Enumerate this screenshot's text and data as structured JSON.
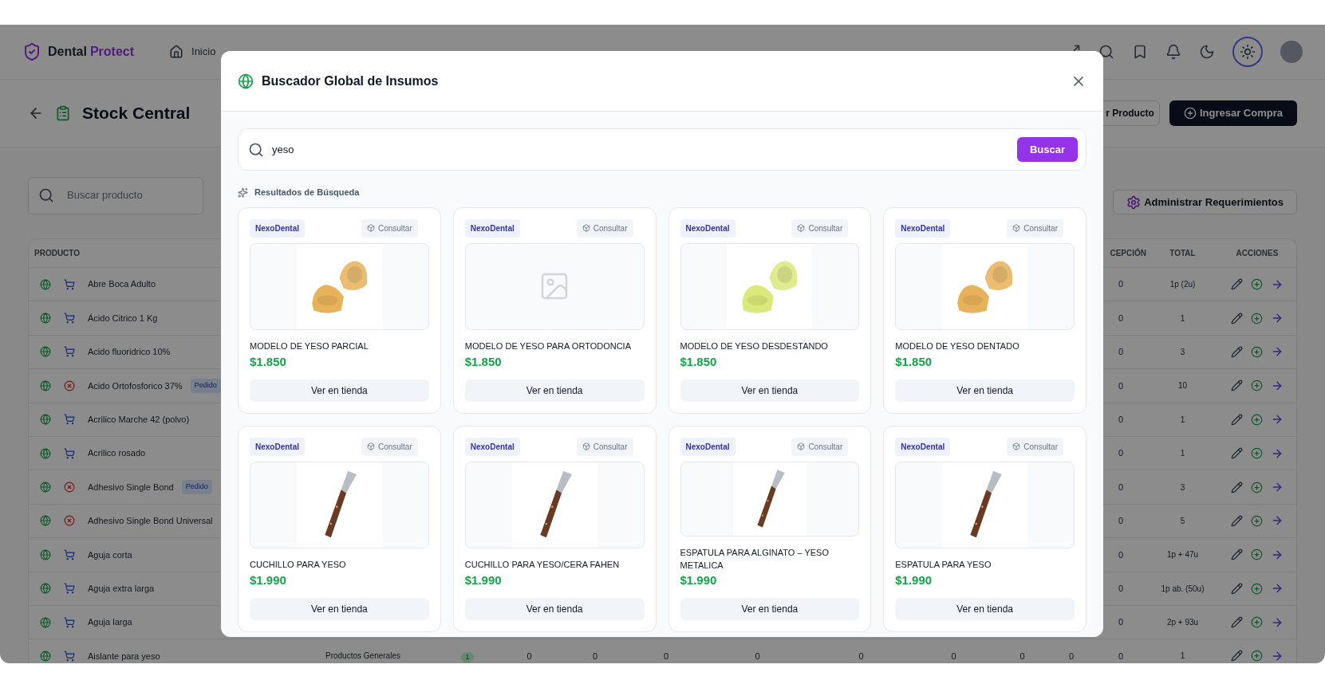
{
  "brand": {
    "name": "Dental",
    "accent": "Protect"
  },
  "nav": [
    "Inicio"
  ],
  "page": {
    "title": "Stock Central",
    "buttons": [
      "r Producto",
      "Ingresar Compra"
    ],
    "search": {
      "placeholder": "Buscar producto"
    },
    "manage_button": "Administrar Requerimientos"
  },
  "table": {
    "columns": {
      "product": "PRODUCTO",
      "reception": "CEPCIÓN",
      "total": "TOTAL",
      "actions": "ACCIONES"
    },
    "rows": [
      {
        "name": "Abre Boca Adulto",
        "kind": "cart",
        "reception": "0",
        "total": "1p (2u)"
      },
      {
        "name": "Ácido Citrico 1 Kg",
        "kind": "cart",
        "reception": "0",
        "total": "1"
      },
      {
        "name": "Acido fluoridrico 10%",
        "kind": "cart",
        "reception": "0",
        "total": "3"
      },
      {
        "name": "Acido Ortofosforico 37%",
        "kind": "cancel",
        "badge": "Pedido",
        "reception": "0",
        "total": "10"
      },
      {
        "name": "Acrilico Marche 42 (polvo)",
        "kind": "cart",
        "reception": "0",
        "total": "1"
      },
      {
        "name": "Acrilico rosado",
        "kind": "cart",
        "reception": "0",
        "total": "1"
      },
      {
        "name": "Adhesivo Single Bond",
        "kind": "cancel",
        "badge": "Pedido",
        "reception": "0",
        "total": "3"
      },
      {
        "name": "Adhesivo Single Bond Universal",
        "kind": "cancel",
        "reception": "0",
        "total": "5"
      },
      {
        "name": "Aguja corta",
        "kind": "cart",
        "reception": "0",
        "total": "1p + 47u"
      },
      {
        "name": "Aguja extra larga",
        "kind": "cart",
        "reception": "0",
        "total": "1p ab. (50u)"
      },
      {
        "name": "Aguja larga",
        "kind": "cart",
        "reception": "0",
        "total": "2p + 93u"
      },
      {
        "name": "Aislante para yeso",
        "kind": "cart",
        "category": "Productos Generales",
        "count": "1",
        "values": [
          "0",
          "0",
          "0",
          "0",
          "0",
          "0",
          "0",
          "0"
        ],
        "reception": "0",
        "total": "1"
      }
    ]
  },
  "modal": {
    "title": "Buscador Global de Insumos",
    "search": {
      "value": "yeso"
    },
    "search_button": "Buscar",
    "results_label": "Resultados de Búsqueda",
    "results": [
      {
        "store": "NexoDental",
        "consult": "Consultar",
        "kind": "cast",
        "name": "MODELO DE YESO PARCIAL",
        "price": "$1.850",
        "button": "Ver en tienda"
      },
      {
        "store": "NexoDental",
        "consult": "Consultar",
        "kind": "placeholder",
        "name": "MODELO DE YESO PARA ORTODONCIA",
        "price": "$1.850",
        "button": "Ver en tienda"
      },
      {
        "store": "NexoDental",
        "consult": "Consultar",
        "kind": "cast",
        "name": "MODELO DE YESO DESDESTANDO",
        "price": "$1.850",
        "button": "Ver en tienda"
      },
      {
        "store": "NexoDental",
        "consult": "Consultar",
        "kind": "cast",
        "name": "MODELO DE YESO DENTADO",
        "price": "$1.850",
        "button": "Ver en tienda"
      },
      {
        "store": "NexoDental",
        "consult": "Consultar",
        "kind": "knife",
        "name": "CUCHILLO PARA YESO",
        "price": "$1.990",
        "button": "Ver en tienda"
      },
      {
        "store": "NexoDental",
        "consult": "Consultar",
        "kind": "knife",
        "name": "CUCHILLO PARA YESO/CERA FAHEN",
        "price": "$1.990",
        "button": "Ver en tienda"
      },
      {
        "store": "NexoDental",
        "consult": "Consultar",
        "kind": "knife",
        "name": "ESPATULA PARA ALGINATO – YESO METALICA",
        "price": "$1.990",
        "button": "Ver en tienda"
      },
      {
        "store": "NexoDental",
        "consult": "Consultar",
        "kind": "knife",
        "name": "ESPATULA PARA YESO",
        "price": "$1.990",
        "button": "Ver en tienda"
      }
    ]
  }
}
